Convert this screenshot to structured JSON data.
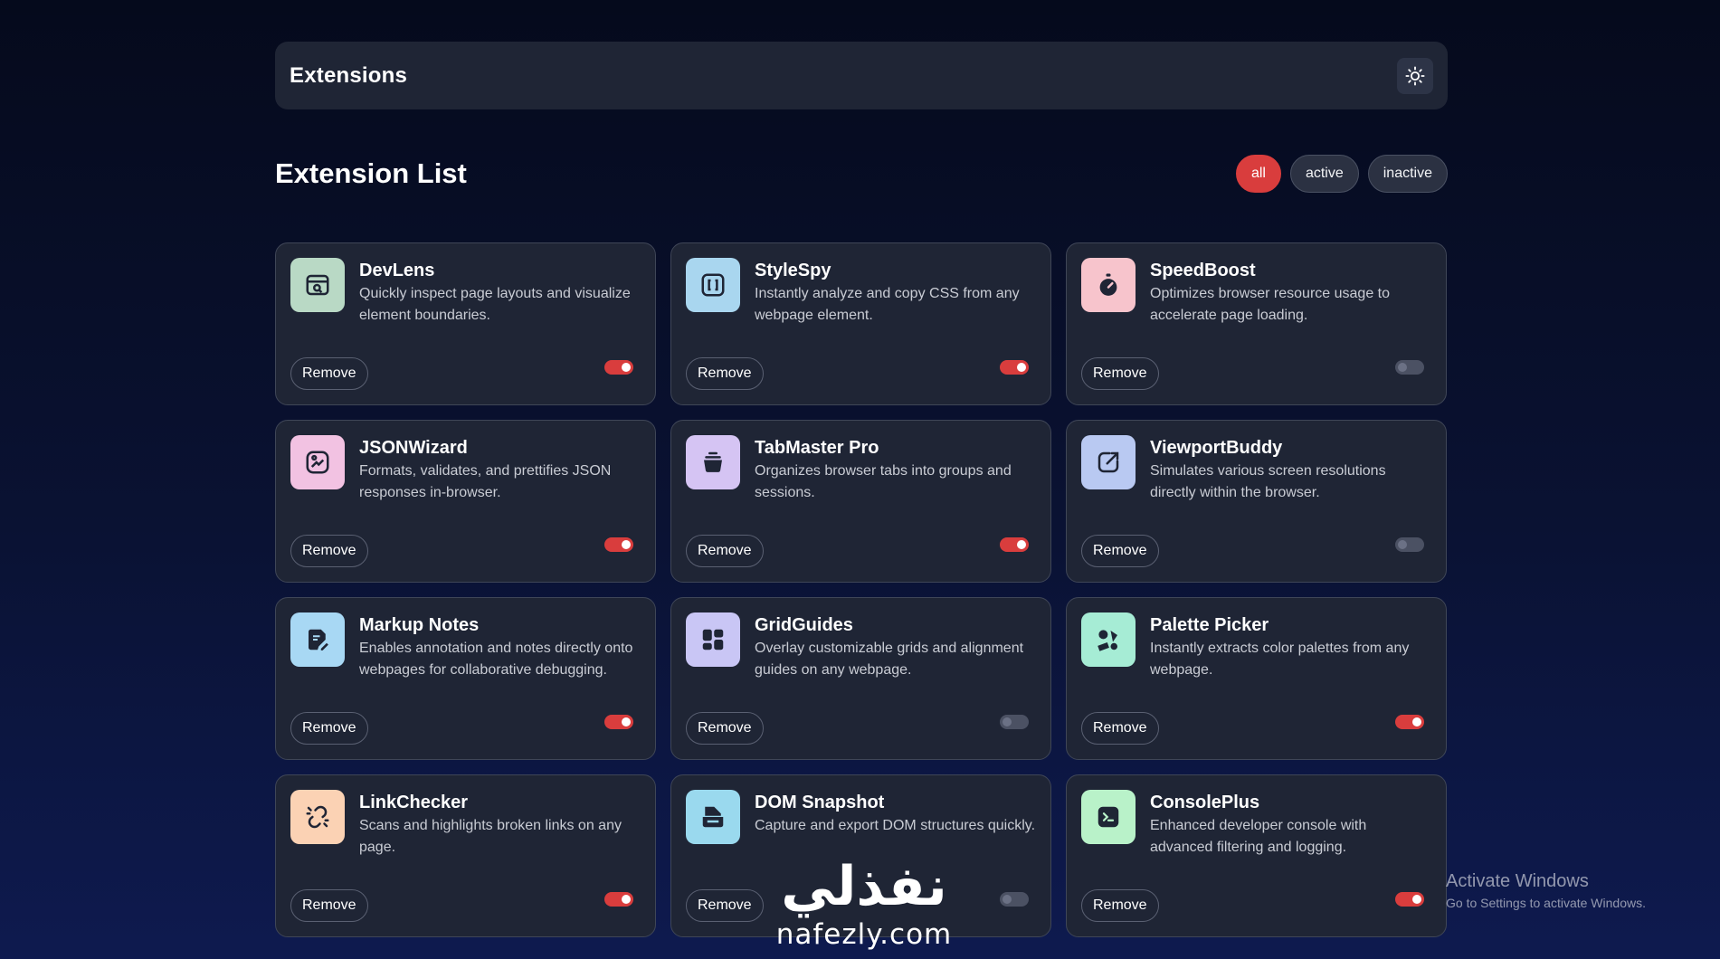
{
  "header": {
    "title": "Extensions",
    "theme_icon": "sun-icon"
  },
  "list": {
    "title": "Extension List",
    "filters": [
      {
        "label": "all",
        "selected": true
      },
      {
        "label": "active",
        "selected": false
      },
      {
        "label": "inactive",
        "selected": false
      }
    ]
  },
  "colors": {
    "accent": "#d93d3d",
    "card_bg": "#1f2535",
    "toggle_off": "#4b5163"
  },
  "extensions": [
    {
      "name": "DevLens",
      "description": "Quickly inspect page layouts and visualize element boundaries.",
      "remove_label": "Remove",
      "active": true,
      "icon": "inspect-window-icon",
      "icon_bg": "#b9d9c5"
    },
    {
      "name": "StyleSpy",
      "description": "Instantly analyze and copy CSS from any webpage element.",
      "remove_label": "Remove",
      "active": true,
      "icon": "brackets-icon",
      "icon_bg": "#a9d6ef"
    },
    {
      "name": "SpeedBoost",
      "description": "Optimizes browser resource usage to accelerate page loading.",
      "remove_label": "Remove",
      "active": false,
      "icon": "stopwatch-icon",
      "icon_bg": "#f7c4cc"
    },
    {
      "name": "JSONWizard",
      "description": "Formats, validates, and prettifies JSON responses in-browser.",
      "remove_label": "Remove",
      "active": true,
      "icon": "magic-image-icon",
      "icon_bg": "#f2c2e2"
    },
    {
      "name": "TabMaster Pro",
      "description": "Organizes browser tabs into groups and sessions.",
      "remove_label": "Remove",
      "active": true,
      "icon": "stack-tabs-icon",
      "icon_bg": "#d5c4f3"
    },
    {
      "name": "ViewportBuddy",
      "description": "Simulates various screen resolutions directly within the browser.",
      "remove_label": "Remove",
      "active": false,
      "icon": "expand-arrow-icon",
      "icon_bg": "#b9c9f2"
    },
    {
      "name": "Markup Notes",
      "description": "Enables annotation and notes directly onto webpages for collaborative debugging.",
      "remove_label": "Remove",
      "active": true,
      "icon": "note-pen-icon",
      "icon_bg": "#a8d8f4"
    },
    {
      "name": "GridGuides",
      "description": "Overlay customizable grids and alignment guides on any webpage.",
      "remove_label": "Remove",
      "active": false,
      "icon": "grid-blocks-icon",
      "icon_bg": "#c9c6f5"
    },
    {
      "name": "Palette Picker",
      "description": "Instantly extracts color palettes from any webpage.",
      "remove_label": "Remove",
      "active": true,
      "icon": "palette-shapes-icon",
      "icon_bg": "#a6ecd5"
    },
    {
      "name": "LinkChecker",
      "description": "Scans and highlights broken links on any page.",
      "remove_label": "Remove",
      "active": true,
      "icon": "broken-link-icon",
      "icon_bg": "#fbd2b4"
    },
    {
      "name": "DOM Snapshot",
      "description": "Capture and export DOM structures quickly.",
      "remove_label": "Remove",
      "active": false,
      "icon": "snapshot-folder-icon",
      "icon_bg": "#9ad9ee"
    },
    {
      "name": "ConsolePlus",
      "description": "Enhanced developer console with advanced filtering and logging.",
      "remove_label": "Remove",
      "active": true,
      "icon": "terminal-icon",
      "icon_bg": "#b9f2c9"
    }
  ],
  "watermark": {
    "line1": "Activate Windows",
    "line2": "Go to Settings to activate Windows."
  },
  "logo": {
    "arabic": "نفذلي",
    "latin": "nafezly.com"
  }
}
